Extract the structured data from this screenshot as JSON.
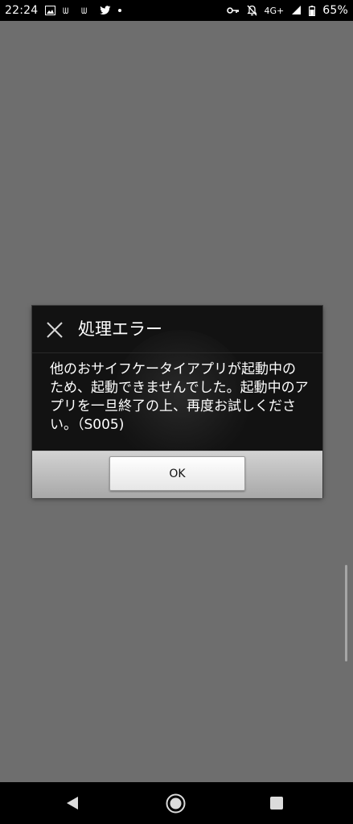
{
  "status_bar": {
    "time": "22:24",
    "network": "4G+",
    "battery": "65%",
    "left_icons": [
      "image-icon",
      "signal-app-icon",
      "signal-app-icon",
      "twitter-icon",
      "dot-icon"
    ],
    "right_icons": [
      "key-icon",
      "bell-off-icon",
      "signal-strength-icon",
      "battery-icon"
    ]
  },
  "dialog": {
    "title": "処理エラー",
    "message": "他のおサイフケータイアプリが起動中のため、起動できませんでした。起動中のアプリを一旦終了の上、再度お試しください。（S005)",
    "ok_label": "OK"
  },
  "nav_bar": {
    "icons": [
      "back-icon",
      "home-icon",
      "recents-icon"
    ]
  },
  "colors": {
    "background": "#6e6e6e",
    "dialog_bg": "#121212",
    "button_bar": "#bdbdbd"
  }
}
